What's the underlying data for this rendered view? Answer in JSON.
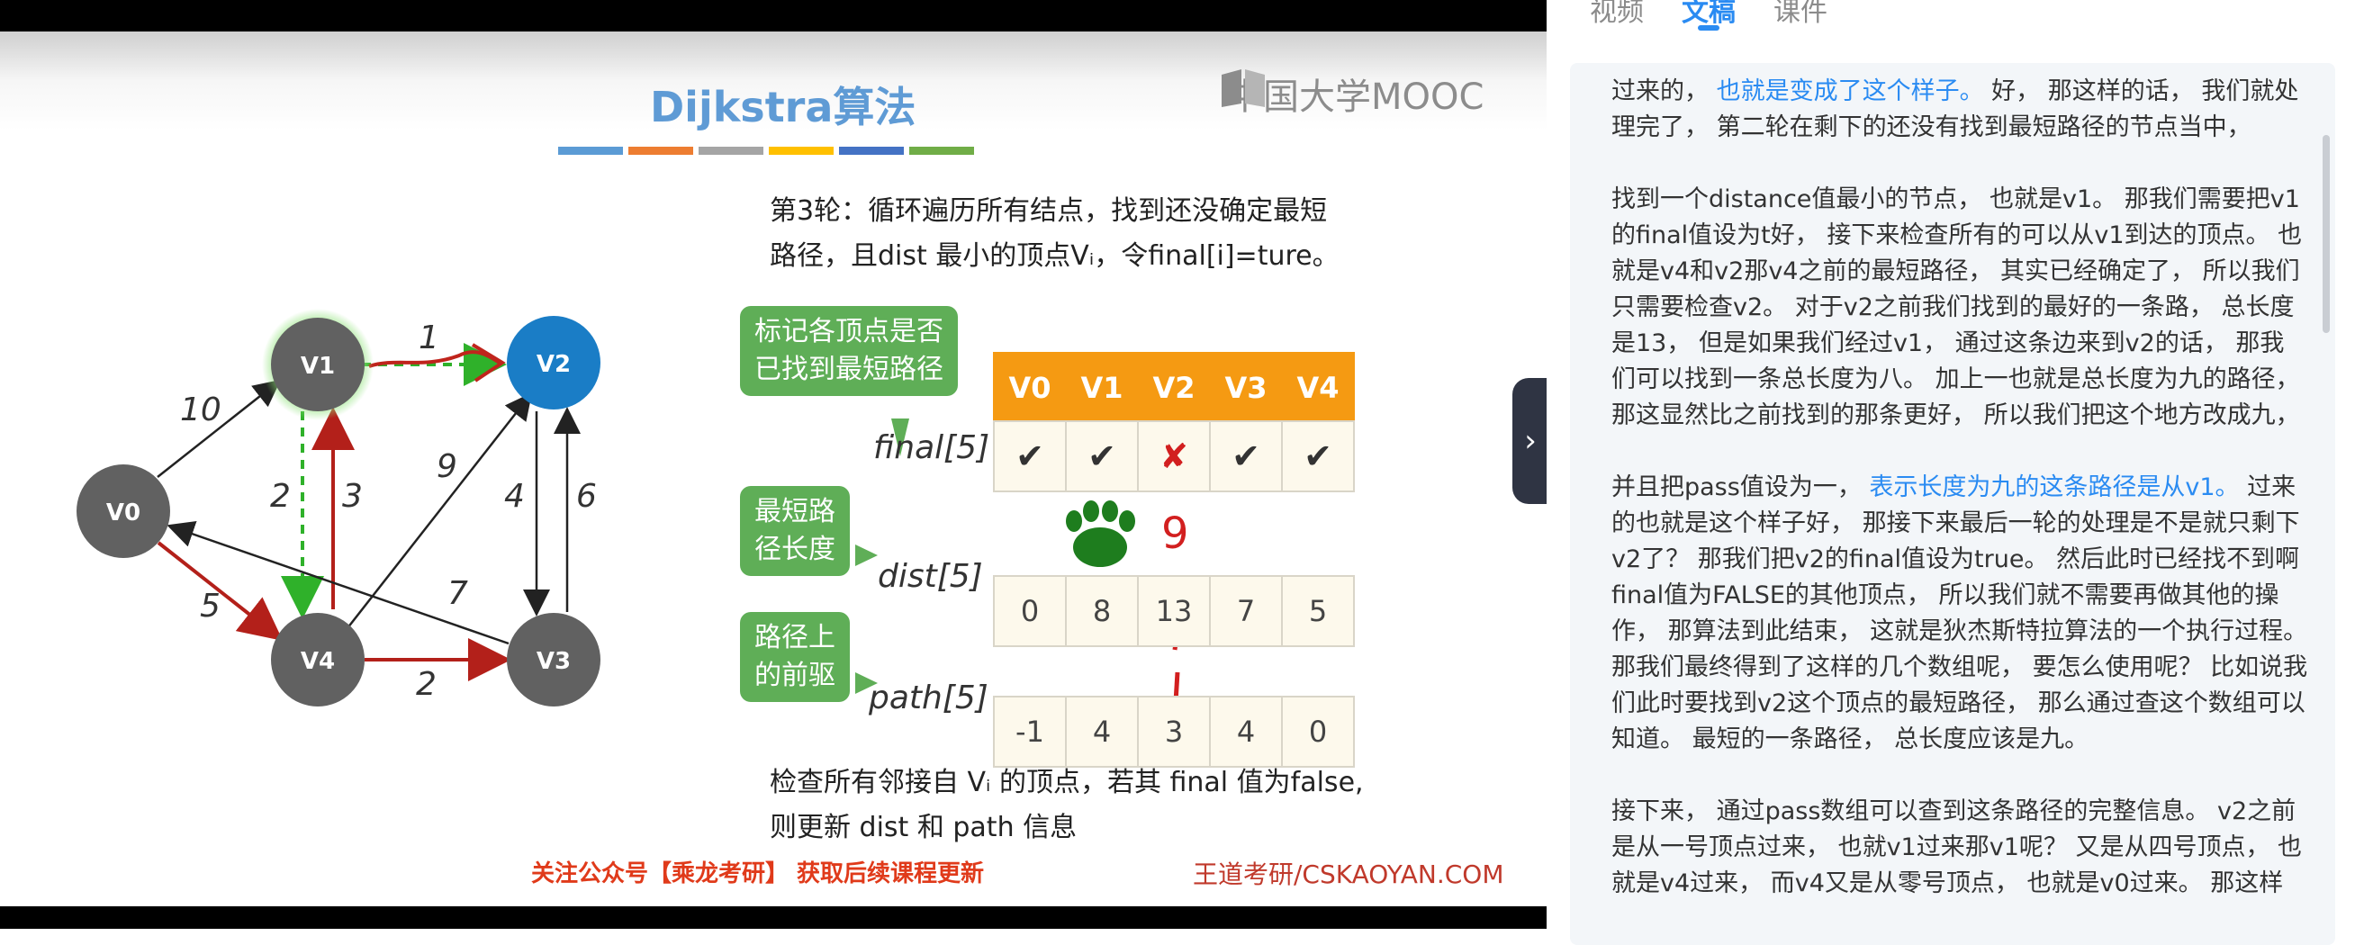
{
  "slide": {
    "title": "Dijkstra算法",
    "brand_logo": "中国大学MOOC",
    "color_bar": [
      "#5b9bd5",
      "#ed7d31",
      "#a5a5a5",
      "#ffc000",
      "#4472c4",
      "#70ad47"
    ],
    "round_text_1": "第3轮：循环遍历所有结点，找到还没确定最短",
    "round_text_2": "路径，且dist 最小的顶点Vᵢ，令final[i]=ture。",
    "callouts": {
      "final": [
        "标记各顶点是否",
        "已找到最短路径"
      ],
      "dist": [
        "最短路",
        "径长度"
      ],
      "path": [
        "路径上",
        "的前驱"
      ]
    },
    "graph": {
      "nodes": [
        "V0",
        "V1",
        "V2",
        "V3",
        "V4"
      ],
      "edges": [
        {
          "from": "V0",
          "to": "V1",
          "weight": "10"
        },
        {
          "from": "V1",
          "to": "V2",
          "weight": "1"
        },
        {
          "from": "V1",
          "to": "V4",
          "weight": "2"
        },
        {
          "from": "V4",
          "to": "V1",
          "weight": "3"
        },
        {
          "from": "V4",
          "to": "V2",
          "weight": "9"
        },
        {
          "from": "V2",
          "to": "V3",
          "weight": "4"
        },
        {
          "from": "V3",
          "to": "V2",
          "weight": "6"
        },
        {
          "from": "V0",
          "to": "V4",
          "weight": "5"
        },
        {
          "from": "V3",
          "to": "V0",
          "weight": "7"
        },
        {
          "from": "V4",
          "to": "V3",
          "weight": "2"
        }
      ]
    },
    "table": {
      "headers": [
        "V0",
        "V1",
        "V2",
        "V3",
        "V4"
      ],
      "row_labels": {
        "final": "final[5]",
        "dist": "dist[5]",
        "path": "path[5]"
      },
      "final": [
        "✔",
        "✔",
        "✘",
        "✔",
        "✔"
      ],
      "dist": [
        "0",
        "8",
        "13",
        "7",
        "5"
      ],
      "path": [
        "-1",
        "4",
        "3",
        "4",
        "0"
      ],
      "handwritten_dist_note": "9"
    },
    "bottom_text_1": "检查所有邻接自 Vᵢ 的顶点，若其 final 值为false,",
    "bottom_text_2": "则更新 dist 和 path 信息",
    "footer_ad": "关注公众号【乘龙考研】 获取后续课程更新",
    "footer_brand": "王道考研/CSKAOYAN.COM"
  },
  "panel": {
    "tabs": [
      {
        "label": "视频",
        "active": false
      },
      {
        "label": "文稿",
        "active": true
      },
      {
        "label": "课件",
        "active": false
      }
    ],
    "paragraphs": [
      [
        {
          "t": "过来的，  ",
          "hl": false
        },
        {
          "t": "也就是变成了这个样子。",
          "hl": true
        },
        {
          "t": " 好，  那这样的话，  我们就处理完了，  第二轮在剩下的还没有找到最短路径的节点当中，",
          "hl": false
        }
      ],
      [
        {
          "t": "找到一个distance值最小的节点，  也就是v1。  那我们需要把v1的final值设为t好，  接下来检查所有的可以从v1到达的顶点。  也就是v4和v2那v4之前的最短路径，  其实已经确定了，  所以我们只需要检查v2。  对于v2之前我们找到的最好的一条路，  总长度是13，  但是如果我们经过v1，  通过这条边来到v2的话，  那我们可以找到一条总长度为八。  加上一也就是总长度为九的路径，  那这显然比之前找到的那条更好，  所以我们把这个地方改成九，",
          "hl": false
        }
      ],
      [
        {
          "t": "并且把pass值设为一，  ",
          "hl": false
        },
        {
          "t": "表示长度为九的这条路径是从v1。",
          "hl": true
        },
        {
          "t": "  过来的也就是这个样子好，  那接下来最后一轮的处理是不是就只剩下v2了？  那我们把v2的final值设为true。  然后此时已经找不到啊final值为FALSE的其他顶点，  所以我们就不需要再做其他的操作，  那算法到此结束，  这就是狄杰斯特拉算法的一个执行过程。  那我们最终得到了这样的几个数组呢，  要怎么使用呢？  比如说我们此时要找到v2这个顶点的最短路径，  那么通过查这个数组可以知道。  最短的一条路径，  总长度应该是九。",
          "hl": false
        }
      ],
      [
        {
          "t": "接下来，  通过pass数组可以查到这条路径的完整信息。  v2之前是从一号顶点过来，  也就v1过来那v1呢？  又是从四号顶点，  也就是v4过来，  而v4又是从零号顶点，  也就是v0过来。  那这样",
          "hl": false
        }
      ]
    ]
  }
}
